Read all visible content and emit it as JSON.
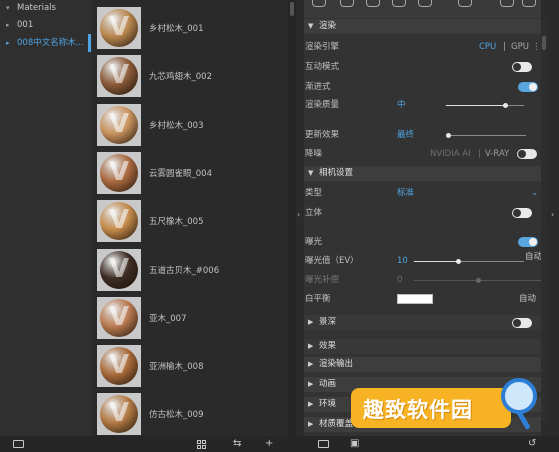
{
  "tree": {
    "items": [
      {
        "label": "Materials",
        "expanded": true
      },
      {
        "label": "001",
        "expanded": false
      },
      {
        "label": "008中文名称木...",
        "expanded": false,
        "selected": true
      }
    ]
  },
  "materials": [
    {
      "name": "乡村松木_001",
      "color": "#b9874f"
    },
    {
      "name": "九芯鸡翅木_002",
      "color": "#8a5a37"
    },
    {
      "name": "乡村松木_003",
      "color": "#c9935d"
    },
    {
      "name": "云雾圆雀眼_004",
      "color": "#a9693f"
    },
    {
      "name": "五尺橡木_005",
      "color": "#c48a4a"
    },
    {
      "name": "五道古贝木_#006",
      "color": "#3d2c23"
    },
    {
      "name": "亚木_007",
      "color": "#b87a50"
    },
    {
      "name": "亚洲榆木_008",
      "color": "#a86a3a"
    },
    {
      "name": "仿古松木_009",
      "color": "#b27a44"
    }
  ],
  "settings": {
    "render_section": {
      "title": "渲染",
      "engine_label": "渲染引擎",
      "engine_cpu": "CPU",
      "engine_gpu": "GPU",
      "interactive_label": "互动模式",
      "interactive_on": false,
      "progressive_label": "渐进式",
      "progressive_on": true,
      "quality_label": "渲染质量",
      "quality_value": "中",
      "quality_level": 0.75,
      "update_label": "更新效果",
      "update_value": "最终",
      "update_level": 0.0,
      "denoise_label": "降噪",
      "denoise_nvidia": "NVIDIA AI",
      "denoise_vray": "V-RAY",
      "denoise_on": false
    },
    "camera_section": {
      "title": "相机设置",
      "type_label": "类型",
      "type_value": "标准",
      "stereo_label": "立体",
      "stereo_on": false,
      "exposure_label": "曝光",
      "exposure_on": true,
      "ev_label": "曝光值（EV）",
      "ev_value": "10",
      "ev_level": 0.4,
      "ev_auto": "自动",
      "comp_label": "曝光补偿",
      "comp_value": "0",
      "comp_level": 0.5,
      "wb_label": "白平衡",
      "wb_color": "#ffffff",
      "wb_auto": "自动",
      "dof_label": "景深",
      "dof_on": false,
      "effects_label": "效果"
    },
    "collapsed_sections": [
      "渲染输出",
      "动画",
      "环境",
      "材质覆盖"
    ]
  },
  "watermark": {
    "text": "趣致软件园"
  }
}
